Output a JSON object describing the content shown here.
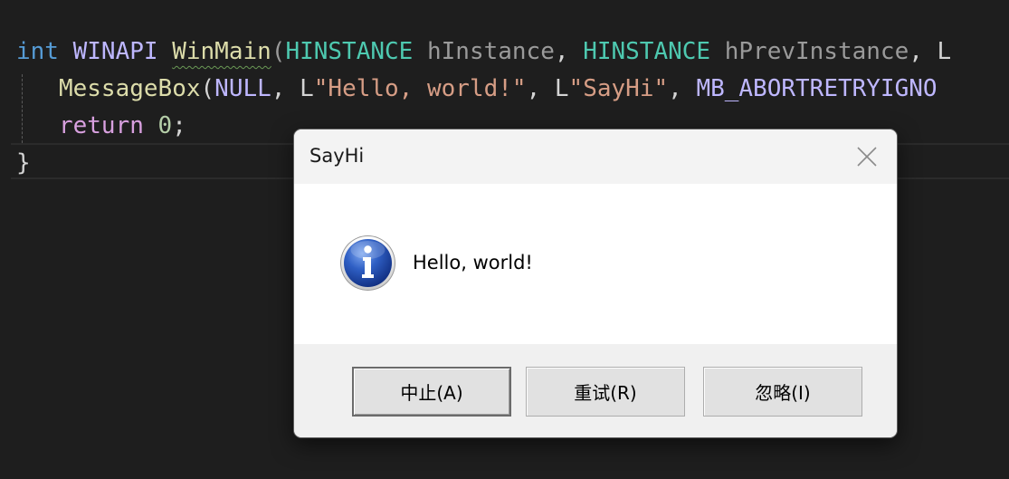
{
  "editor": {
    "line1": {
      "kw_int": "int",
      "winapi": "WINAPI",
      "winmain": "WinMain",
      "open_paren": "(",
      "type1": "HINSTANCE",
      "param1": "hInstance",
      "comma1": ", ",
      "type2": "HINSTANCE",
      "param2": "hPrevInstance",
      "comma2": ", ",
      "tail": "L"
    },
    "line2": {
      "func": "MessageBox",
      "open": "(",
      "null": "NULL",
      "comma1": ", ",
      "prefix1": "L",
      "str1": "\"Hello, world!\"",
      "comma2": ", ",
      "prefix2": "L",
      "str2": "\"SayHi\"",
      "comma3": ", ",
      "flag": "MB_ABORTRETRYIGNO"
    },
    "line3": {
      "kw_return": "return",
      "value": "0",
      "semi": ";"
    },
    "line4": {
      "brace": "}"
    }
  },
  "dialog": {
    "title": "SayHi",
    "message": "Hello, world!",
    "icon": "information-icon",
    "buttons": {
      "abort": "中止(A)",
      "retry": "重试(R)",
      "ignore": "忽略(I)"
    },
    "default_button": "abort"
  },
  "colors": {
    "editor_background": "#1e1e1e",
    "keyword": "#569cd6",
    "macro": "#beb7ff",
    "function": "#dcdcaa",
    "type": "#4ec9b0",
    "string": "#d69d85",
    "control_keyword": "#d8a0df",
    "dialog_content": "#ffffff",
    "dialog_footer": "#f0f0f0"
  }
}
